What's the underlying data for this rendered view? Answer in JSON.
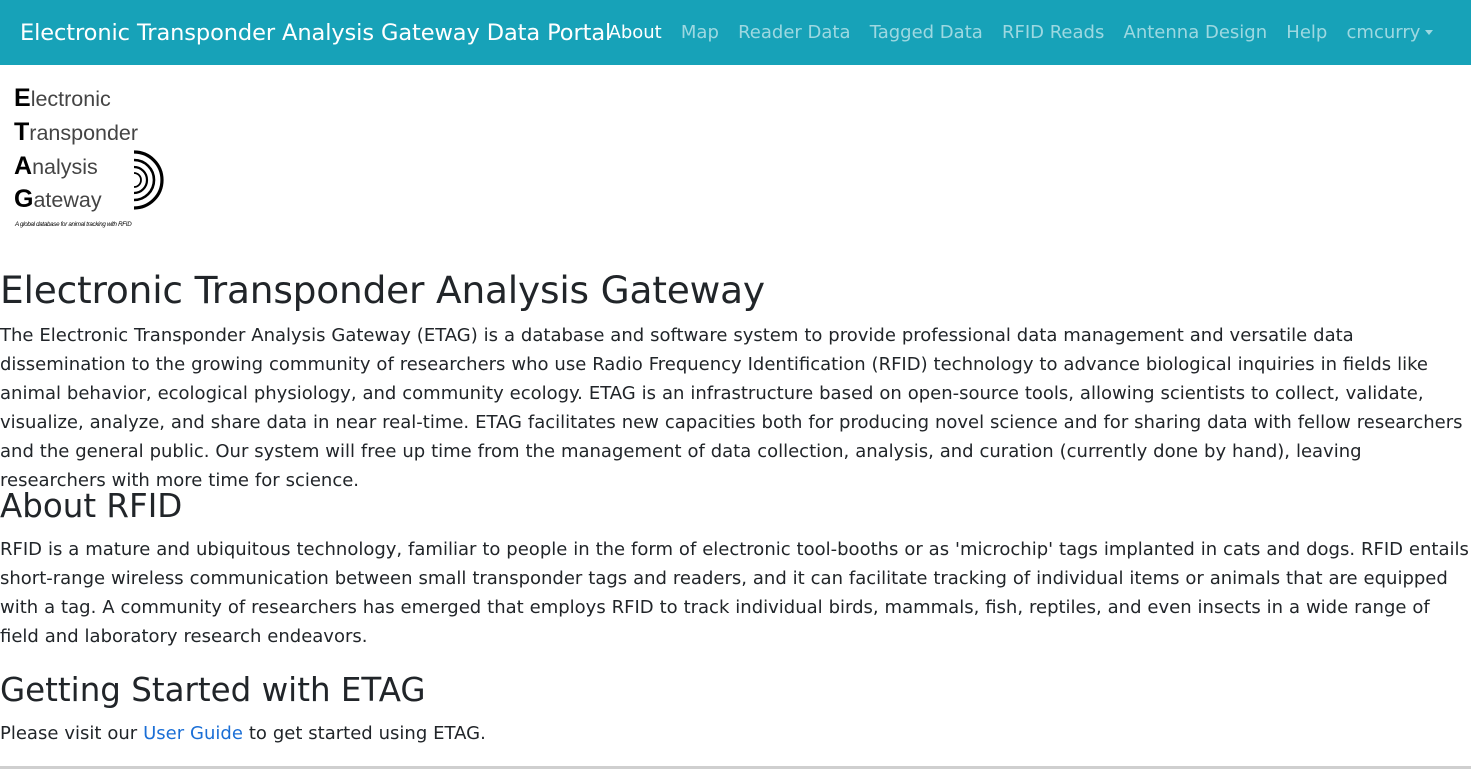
{
  "navbar": {
    "brand": "Electronic Transponder Analysis Gateway Data Portal",
    "links": [
      {
        "label": "About",
        "active": true
      },
      {
        "label": "Map",
        "active": false
      },
      {
        "label": "Reader Data",
        "active": false
      },
      {
        "label": "Tagged Data",
        "active": false
      },
      {
        "label": "RFID Reads",
        "active": false
      },
      {
        "label": "Antenna Design",
        "active": false
      },
      {
        "label": "Help",
        "active": false
      }
    ],
    "user_menu": "cmcurry"
  },
  "logo": {
    "lines": [
      {
        "cap": "E",
        "rest": "lectronic"
      },
      {
        "cap": "T",
        "rest": "ransponder"
      },
      {
        "cap": "A",
        "rest": "nalysis"
      },
      {
        "cap": "G",
        "rest": "ateway"
      }
    ],
    "tagline": "A global database for animal tracking with RFID",
    "icon": "rfid-waves-icon"
  },
  "main": {
    "title": "Electronic Transponder Analysis Gateway",
    "intro": "The Electronic Transponder Analysis Gateway (ETAG) is a database and software system to provide professional data management and versatile data dissemination to the growing community of researchers who use Radio Frequency Identification (RFID) technology to advance biological inquiries in fields like animal behavior, ecological physiology, and community ecology. ETAG is an infrastructure based on open-source tools, allowing scientists to collect, validate, visualize, analyze, and share data in near real-time. ETAG facilitates new capacities both for producing novel science and for sharing data with fellow researchers and the general public. Our system will free up time from the management of data collection, analysis, and curation (currently done by hand), leaving researchers with more time for science.",
    "about_rfid_title": "About RFID",
    "about_rfid_text": "RFID is a mature and ubiquitous technology, familiar to people in the form of electronic tool-booths or as 'microchip' tags implanted in cats and dogs. RFID entails short-range wireless communication between small transponder tags and readers, and it can facilitate tracking of individual items or animals that are equipped with a tag. A community of researchers has emerged that employs RFID to track individual birds, mammals, fish, reptiles, and even insects in a wide range of field and laboratory research endeavors.",
    "getting_started_title": "Getting Started with ETAG",
    "getting_started_prefix": "Please visit our ",
    "getting_started_link": "User Guide",
    "getting_started_suffix": " to get started using ETAG."
  },
  "colors": {
    "navbar_bg": "#17a2b8",
    "link": "#1b6fd6",
    "text": "#212529"
  }
}
